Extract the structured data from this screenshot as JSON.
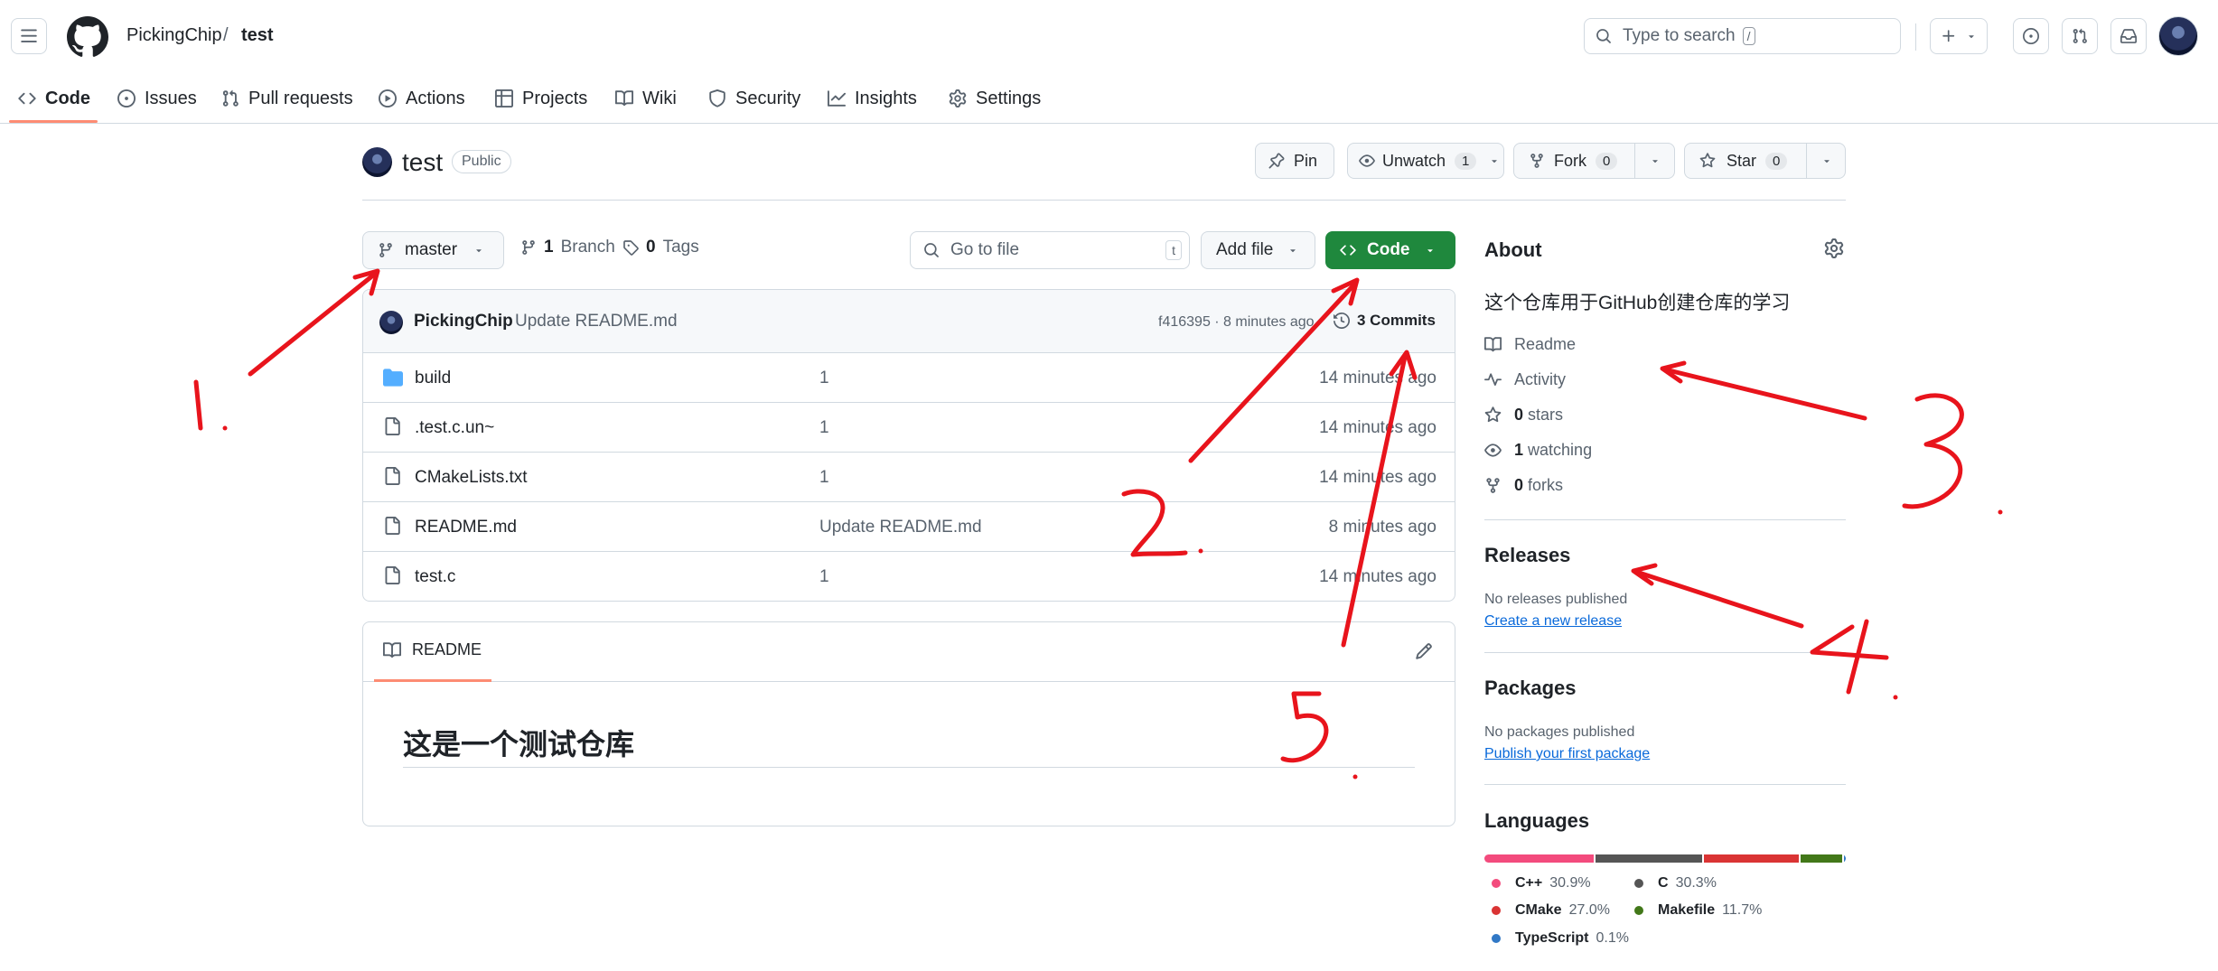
{
  "header": {
    "owner": "PickingChip",
    "separator": "/",
    "repo": "test",
    "search_placeholder": "Type to search",
    "search_shortcut": "/"
  },
  "nav": {
    "items": [
      {
        "label": "Code",
        "icon": "code-icon"
      },
      {
        "label": "Issues",
        "icon": "issue-icon"
      },
      {
        "label": "Pull requests",
        "icon": "pull-request-icon"
      },
      {
        "label": "Actions",
        "icon": "play-icon"
      },
      {
        "label": "Projects",
        "icon": "table-icon"
      },
      {
        "label": "Wiki",
        "icon": "book-icon"
      },
      {
        "label": "Security",
        "icon": "shield-icon"
      },
      {
        "label": "Insights",
        "icon": "graph-icon"
      },
      {
        "label": "Settings",
        "icon": "gear-icon"
      }
    ]
  },
  "repo": {
    "name": "test",
    "visibility": "Public",
    "pin_label": "Pin",
    "watch_label": "Unwatch",
    "watch_count": "1",
    "fork_label": "Fork",
    "fork_count": "0",
    "star_label": "Star",
    "star_count": "0"
  },
  "toolbar": {
    "branch": "master",
    "branches_count": "1",
    "branches_label": "Branch",
    "tags_count": "0",
    "tags_label": "Tags",
    "goto_placeholder": "Go to file",
    "goto_shortcut": "t",
    "add_file_label": "Add file",
    "code_label": "Code"
  },
  "latest_commit": {
    "author": "PickingChip",
    "message": "Update README.md",
    "hash_time": "f416395 · 8 minutes ago",
    "commits_label": "3 Commits"
  },
  "files": [
    {
      "name": "build",
      "type": "folder",
      "message": "1",
      "time": "14 minutes ago"
    },
    {
      "name": ".test.c.un~",
      "type": "file",
      "message": "1",
      "time": "14 minutes ago"
    },
    {
      "name": "CMakeLists.txt",
      "type": "file",
      "message": "1",
      "time": "14 minutes ago"
    },
    {
      "name": "README.md",
      "type": "file",
      "message": "Update README.md",
      "time": "8 minutes ago"
    },
    {
      "name": "test.c",
      "type": "file",
      "message": "1",
      "time": "14 minutes ago"
    }
  ],
  "readme": {
    "tab_label": "README",
    "heading": "这是一个测试仓库"
  },
  "about": {
    "title": "About",
    "description": "这个仓库用于GitHub创建仓库的学习",
    "readme_label": "Readme",
    "activity_label": "Activity",
    "stars_count": "0",
    "stars_label": "stars",
    "watching_count": "1",
    "watching_label": "watching",
    "forks_count": "0",
    "forks_label": "forks"
  },
  "releases": {
    "title": "Releases",
    "empty_text": "No releases published",
    "create_link": "Create a new release"
  },
  "packages": {
    "title": "Packages",
    "empty_text": "No packages published",
    "publish_link": "Publish your first package"
  },
  "languages": {
    "title": "Languages",
    "items": [
      {
        "name": "C++",
        "percent": "30.9%",
        "value": 30.9,
        "color": "#f34b7d"
      },
      {
        "name": "C",
        "percent": "30.3%",
        "value": 30.3,
        "color": "#555555"
      },
      {
        "name": "CMake",
        "percent": "27.0%",
        "value": 27.0,
        "color": "#da3434"
      },
      {
        "name": "Makefile",
        "percent": "11.7%",
        "value": 11.7,
        "color": "#427819"
      },
      {
        "name": "TypeScript",
        "percent": "0.1%",
        "value": 0.1,
        "color": "#3178c6"
      }
    ]
  },
  "colors": {
    "accent_underline": "#fd8c73",
    "code_button": "#1f883d",
    "link": "#0969da",
    "annotation": "#e8141c"
  }
}
